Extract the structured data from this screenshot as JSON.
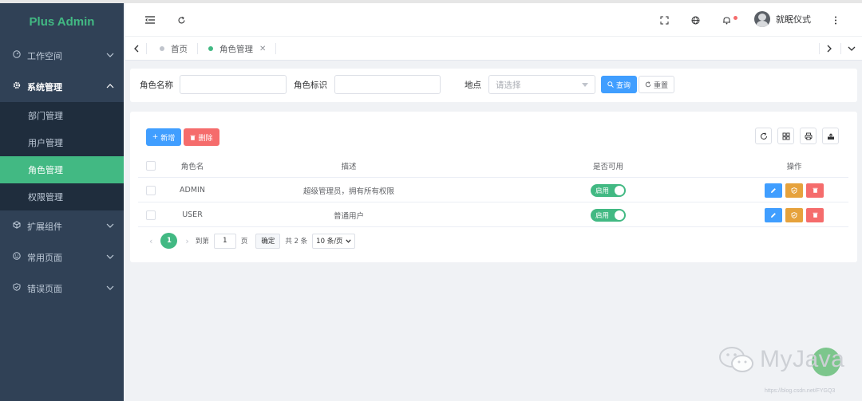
{
  "app": {
    "title": "Plus Admin"
  },
  "sidebar": {
    "items": [
      {
        "label": "工作空间",
        "icon": "dashboard-icon"
      },
      {
        "label": "系统管理",
        "icon": "gear-icon",
        "children": [
          "部门管理",
          "用户管理",
          "角色管理",
          "权限管理"
        ],
        "active_child": "角色管理"
      },
      {
        "label": "扩展组件",
        "icon": "cube-icon"
      },
      {
        "label": "常用页面",
        "icon": "smile-icon"
      },
      {
        "label": "错误页面",
        "icon": "shield-check-icon"
      }
    ]
  },
  "header": {
    "user_name": "就眠仪式"
  },
  "tabs": [
    {
      "label": "首页"
    },
    {
      "label": "角色管理",
      "active": true
    }
  ],
  "search": {
    "role_name_label": "角色名称",
    "role_code_label": "角色标识",
    "location_label": "地点",
    "location_placeholder": "请选择",
    "query_button": "查询",
    "reset_button": "重置"
  },
  "toolbar": {
    "add_button": "新增",
    "delete_button": "删除"
  },
  "table": {
    "headers": {
      "name": "角色名",
      "desc": "描述",
      "enabled": "是否可用",
      "actions": "操作"
    },
    "rows": [
      {
        "name": "ADMIN",
        "desc": "超级管理员，拥有所有权限",
        "enabled": "启用"
      },
      {
        "name": "USER",
        "desc": "普通用户",
        "enabled": "启用"
      }
    ]
  },
  "pagination": {
    "current_page": "1",
    "goto_label": "到第",
    "goto_value": "1",
    "page_unit": "页",
    "confirm_button": "确定",
    "total": "共 2 条",
    "page_size": "10 条/页"
  },
  "watermark": {
    "text": "MyJava",
    "url": "https://blog.csdn.net/FYGQ3"
  },
  "colors": {
    "sidebar_bg": "#304156",
    "accent": "#42b983",
    "primary": "#409eff",
    "danger": "#f56c6c",
    "warning": "#e6a23c"
  }
}
